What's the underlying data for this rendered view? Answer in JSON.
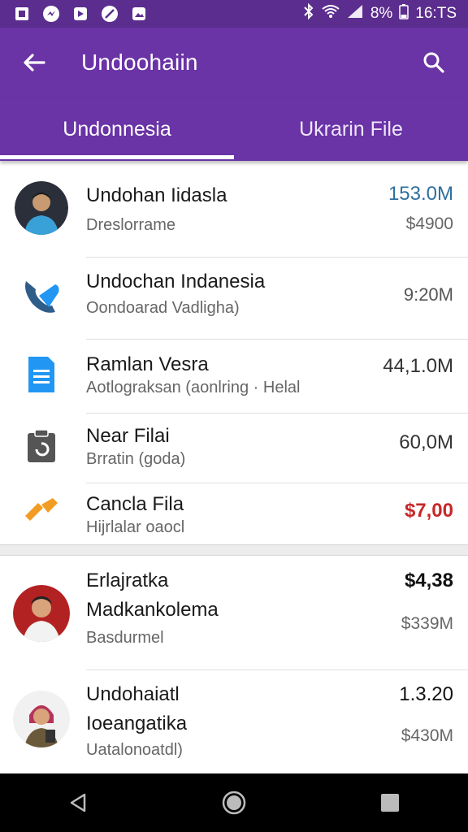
{
  "status_bar": {
    "battery_text": "8%",
    "time": "16:TS",
    "icons": [
      "square-app-icon",
      "messenger-icon",
      "video-icon",
      "no-sign-icon",
      "photo-icon"
    ]
  },
  "app_bar": {
    "title": "Undoohaiin",
    "back_icon": "arrow-left-icon",
    "search_icon": "search-icon"
  },
  "tabs": [
    {
      "label": "Undonnesia",
      "active": true
    },
    {
      "label": "Ukrarin File",
      "active": false
    }
  ],
  "list_a": [
    {
      "title": "Undohan Iidasla",
      "subtitle": "Dreslorrame",
      "amount": "153.0M",
      "amount_sub": "$4900",
      "amount_color": "#2e6f9e",
      "icon": "person-avatar"
    },
    {
      "title": "Undochan Indanesia",
      "subtitle": "Oondoarad  Vadligha)",
      "amount": "9:20M",
      "amount_sub": "",
      "icon": "phone-icon"
    },
    {
      "title": "Ramlan Vesra",
      "subtitle": "Aotlograksan (aonlring · Helal",
      "amount": "44,1.0M",
      "amount_sub": "",
      "icon": "document-icon"
    },
    {
      "title": "Near Filai",
      "subtitle": "Brratin (goda)",
      "amount": "60,0M",
      "amount_sub": "",
      "icon": "clipboard-icon"
    },
    {
      "title": "Cancla Fila",
      "subtitle": "Hijrlalar oaocl",
      "amount": "$7,00",
      "amount_sub": "",
      "amount_color": "#c62828",
      "icon": "tag-icon"
    }
  ],
  "list_b": [
    {
      "title": "Erlajratka",
      "title2": "Madkankolema",
      "subtitle": "Basdurmel",
      "amount": "$4,38",
      "amount_sub": "$339M",
      "icon": "person-avatar"
    },
    {
      "title": "Undohaiatl",
      "title2": "Ioeangatika",
      "subtitle": "Uatalonoatdl)",
      "amount": "1.3.20",
      "amount_sub": "$430M",
      "icon": "person-avatar"
    }
  ],
  "colors": {
    "primary": "#6a33a6",
    "status_bar": "#5b2d8e"
  }
}
